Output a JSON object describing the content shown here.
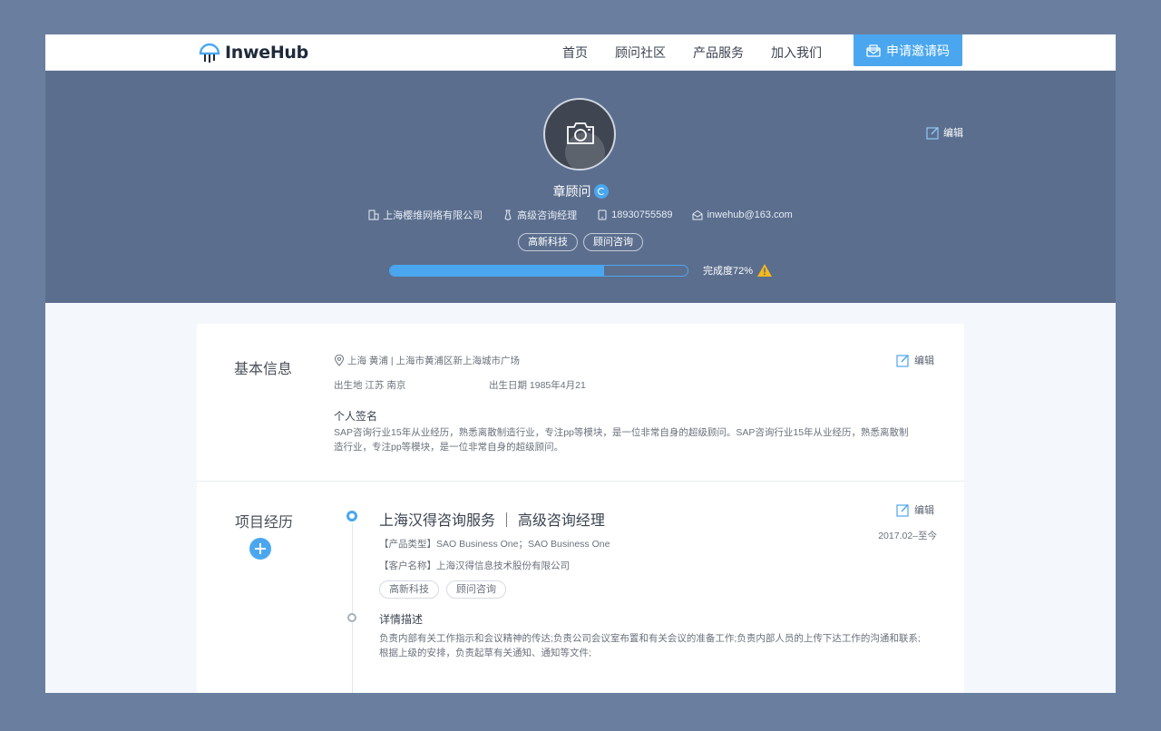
{
  "nav": {
    "logo_text": "InweHub",
    "links": [
      "首页",
      "顾问社区",
      "产品服务",
      "加入我们"
    ],
    "invite_label": "申请邀请码"
  },
  "profile": {
    "name": "章顾问",
    "edit_label": "编辑",
    "company": "上海樱维网络有限公司",
    "title": "高级咨询经理",
    "phone": "18930755589",
    "email": "inwehub@163.com",
    "tags": [
      "高新科技",
      "顾问咨询"
    ],
    "completion_percent": 72,
    "completion_label": "完成度72%"
  },
  "basic_info": {
    "section_title": "基本信息",
    "edit_label": "编辑",
    "address": "上海 黄浦 | 上海市黄浦区新上海城市广场",
    "birthplace": "出生地 江苏 南京",
    "birthday": "出生日期 1985年4月21",
    "signature_title": "个人签名",
    "signature_line1": "SAP咨询行业15年从业经历，熟悉离散制造行业，专注pp等模块，是一位非常自身的超级顾问。SAP咨询行业15年从业经历，熟悉离散制",
    "signature_line2": "造行业，专注pp等模块，是一位非常自身的超级顾问。"
  },
  "projects": {
    "section_title": "项目经历",
    "edit_label": "编辑",
    "items": [
      {
        "title": "上海汉得咨询服务 ｜ 高级咨询经理",
        "date": "2017.02–至今",
        "product_type": "【产品类型】SAO Business One；SAO Business One",
        "client": "【客户名称】上海汉得信息技术股份有限公司",
        "tags": [
          "高新科技",
          "顾问咨询"
        ],
        "detail_title": "详情描述",
        "detail_line1": "负责内部有关工作指示和会议精神的传达;负责公司会议室布置和有关会议的准备工作;负责内部人员的上传下达工作的沟通和联系;",
        "detail_line2": "根据上级的安排，负责起草有关通知、通知等文件;"
      }
    ]
  },
  "colors": {
    "accent": "#4aa7ef",
    "hero_bg": "#5b6e8e",
    "page_bg": "#6a7fa0"
  }
}
